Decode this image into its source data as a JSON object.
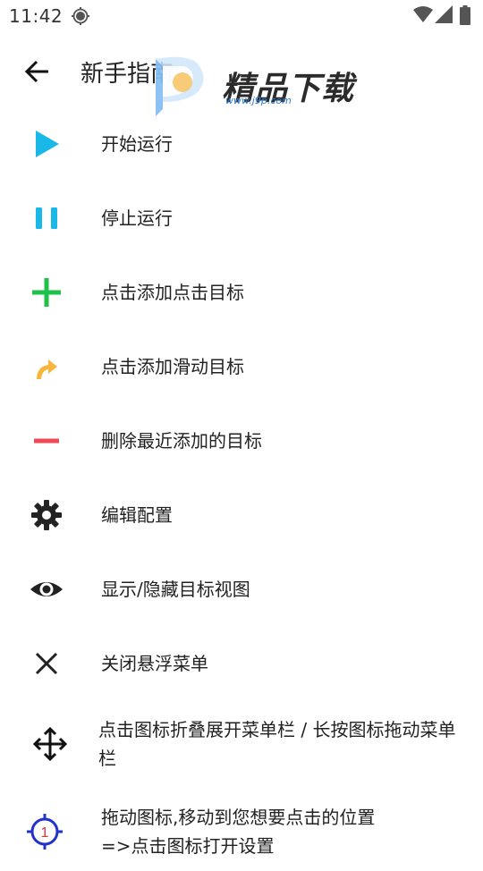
{
  "status": {
    "time": "11:42"
  },
  "header": {
    "title": "新手指南"
  },
  "watermark": {
    "text": "精品下载",
    "url": "www.j9p.com"
  },
  "items": [
    {
      "label": "开始运行",
      "icon": "play-icon",
      "color": "#1ab8e8"
    },
    {
      "label": "停止运行",
      "icon": "pause-icon",
      "color": "#1ab8e8"
    },
    {
      "label": "点击添加点击目标",
      "icon": "plus-icon",
      "color": "#1ec24a"
    },
    {
      "label": "点击添加滑动目标",
      "icon": "swipe-arrow-icon",
      "color": "#f6b73c"
    },
    {
      "label": "删除最近添加的目标",
      "icon": "minus-icon",
      "color": "#ef4a55"
    },
    {
      "label": "编辑配置",
      "icon": "gear-icon",
      "color": "#222222"
    },
    {
      "label": "显示/隐藏目标视图",
      "icon": "eye-icon",
      "color": "#222222"
    },
    {
      "label": "关闭悬浮菜单",
      "icon": "close-icon",
      "color": "#222222"
    },
    {
      "label": "点击图标折叠展开菜单栏 / 长按图标拖动菜单栏",
      "icon": "move-icon",
      "color": "#111111"
    },
    {
      "label": "拖动图标,移动到您想要点击的位置\n=>点击图标打开设置",
      "icon": "target-icon",
      "color": "#2233cc",
      "badge": "1"
    }
  ]
}
